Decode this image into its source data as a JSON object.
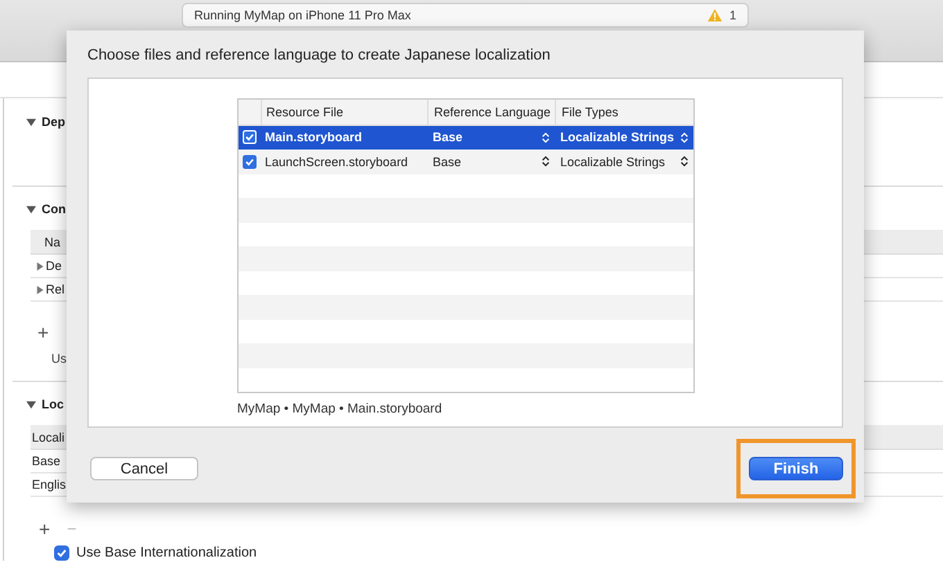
{
  "toolbar": {
    "status": "Running MyMap on iPhone 11 Pro Max",
    "warning_count": "1"
  },
  "project_editor": {
    "deployment": {
      "title": "Dep"
    },
    "configurations": {
      "title": "Con",
      "column": "Na",
      "rows": [
        "De",
        "Rel"
      ],
      "add": "+",
      "note": "Us"
    },
    "localizations": {
      "title": "Loc",
      "column": "Locali",
      "rows": [
        "Base",
        "Englis"
      ],
      "add": "+",
      "remove": "−",
      "base_internationalization": {
        "label": "Use Base Internationalization",
        "checked": true
      }
    }
  },
  "sheet": {
    "title": "Choose files and reference language to create Japanese localization",
    "columns": [
      "Resource File",
      "Reference Language",
      "File Types"
    ],
    "rows": [
      {
        "checked": true,
        "selected": true,
        "file": "Main.storyboard",
        "language": "Base",
        "file_type": "Localizable Strings"
      },
      {
        "checked": true,
        "selected": false,
        "file": "LaunchScreen.storyboard",
        "language": "Base",
        "file_type": "Localizable Strings"
      }
    ],
    "path": "MyMap • MyMap • Main.storyboard",
    "buttons": [
      {
        "label": "Cancel",
        "kind": "secondary",
        "highlighted": false
      },
      {
        "label": "Finish",
        "kind": "primary",
        "highlighted": true
      }
    ]
  }
}
